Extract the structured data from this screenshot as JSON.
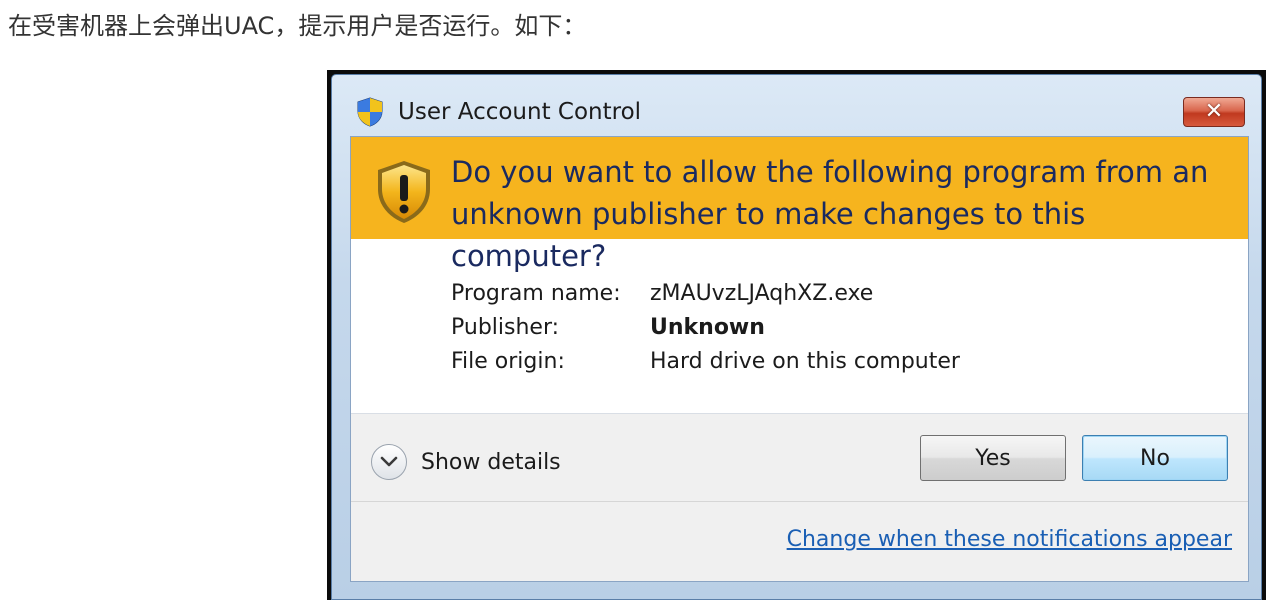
{
  "caption": "在受害机器上会弹出UAC，提示用户是否运行。如下：",
  "dialog": {
    "title": "User Account Control",
    "close_label": "✕",
    "banner_line1": "Do you want to allow the following program from an",
    "banner_line2": "unknown publisher to make changes to this computer?",
    "details": [
      {
        "label": "Program name:",
        "value": "zMAUvzLJAqhXZ.exe"
      },
      {
        "label": "Publisher:",
        "value": "Unknown"
      },
      {
        "label": "File origin:",
        "value": "Hard drive on this computer"
      }
    ],
    "show_details_label": "Show details",
    "yes_label": "Yes",
    "no_label": "No",
    "notification_link": "Change when these notifications appear"
  },
  "colors": {
    "banner": "#f6b41e",
    "banner_text": "#1a2a60",
    "link": "#1a5fb4",
    "close_button": "#c0391f"
  },
  "icons": {
    "title": "uac-shield-icon",
    "banner": "warning-shield-icon",
    "expand": "chevron-down-icon"
  }
}
